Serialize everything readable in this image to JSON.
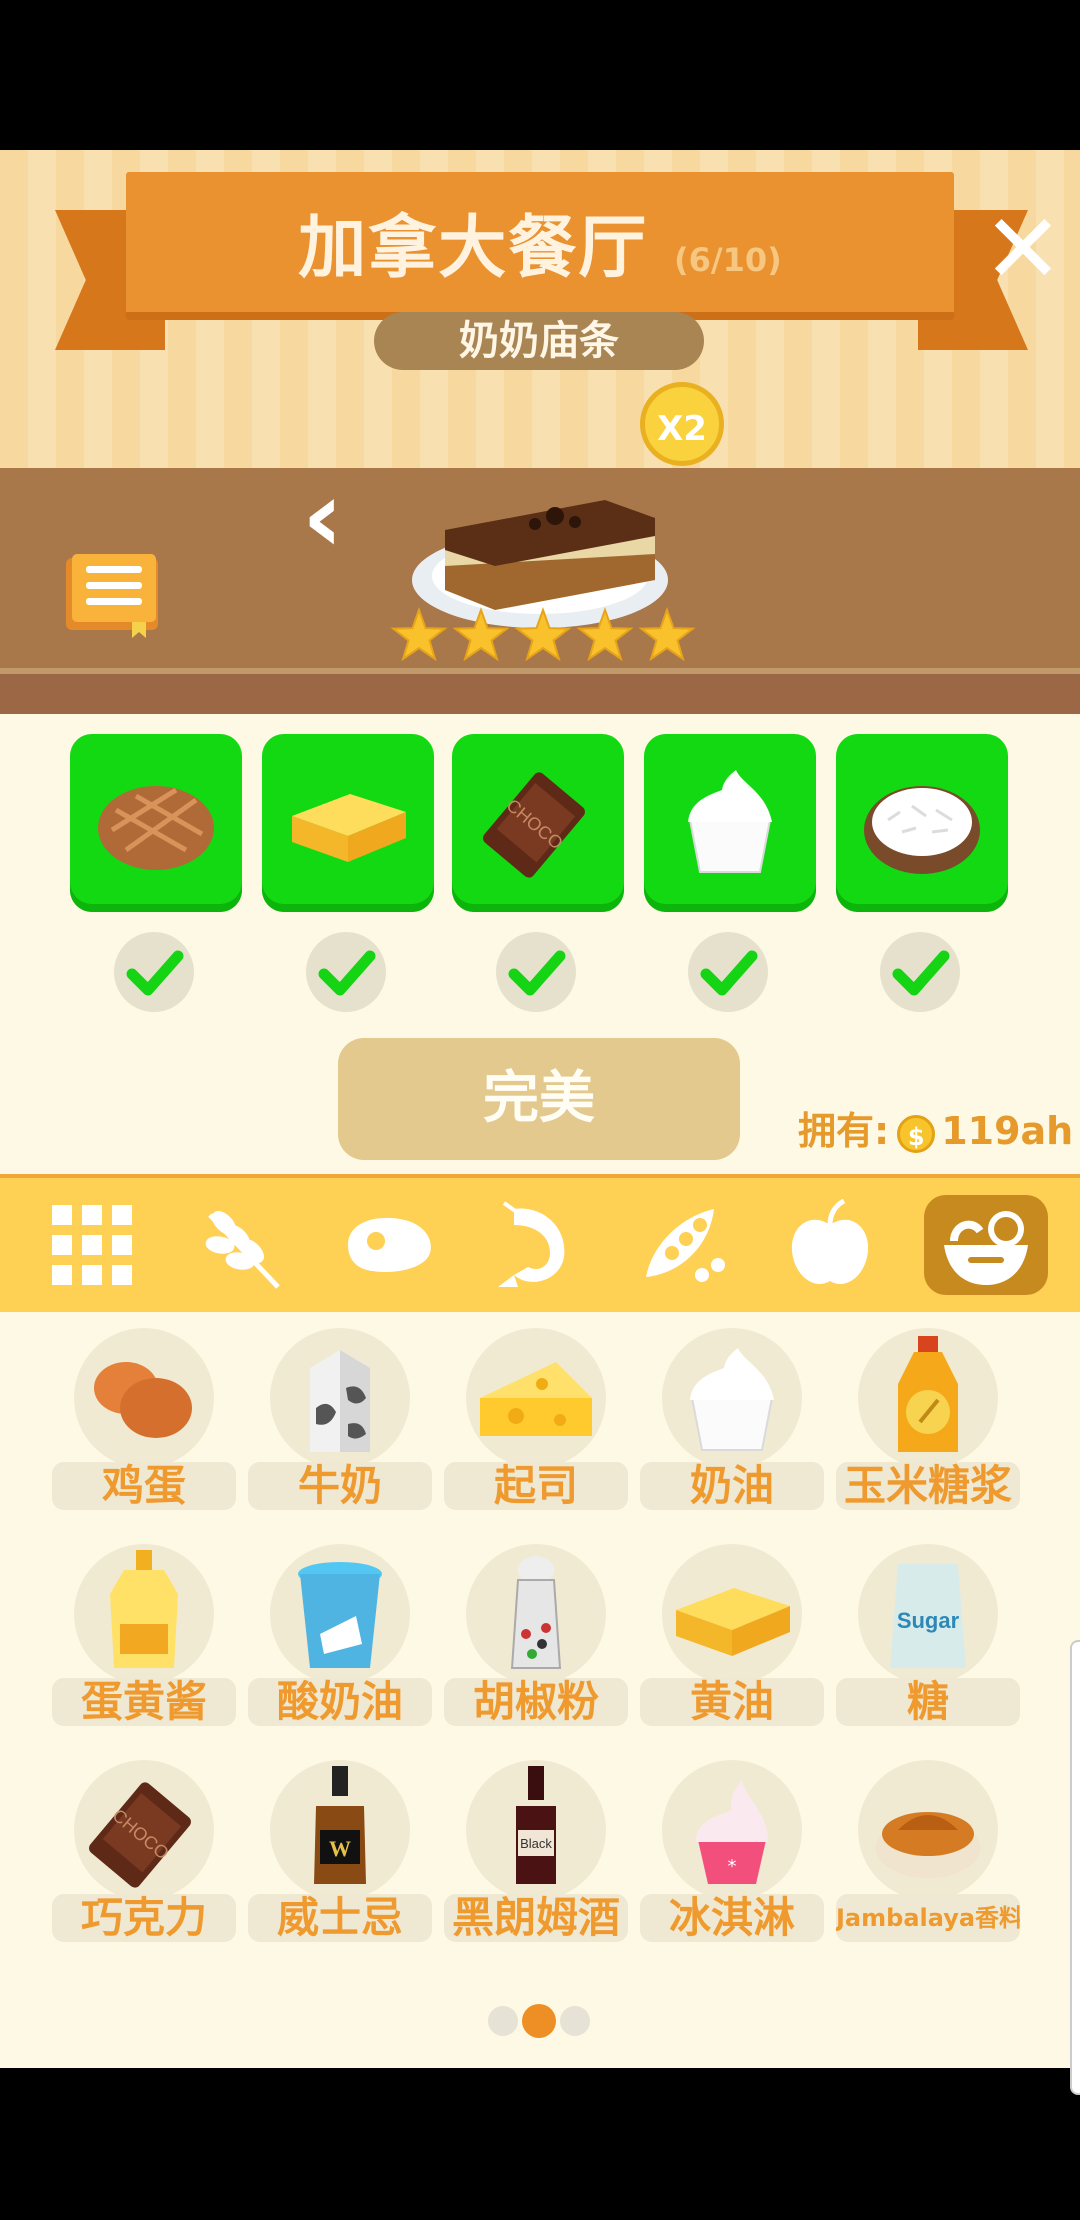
{
  "header": {
    "title": "加拿大餐厅",
    "progress": "(6/10)",
    "subtitle": "奶奶庙条",
    "multiplier": "X2",
    "close_icon": "close-icon"
  },
  "dish": {
    "name_icon": "chocolate-cake-dish",
    "stars": 5,
    "star_color": "#f9c22d"
  },
  "required_ingredients": [
    {
      "icon": "bread-icon",
      "checked": true
    },
    {
      "icon": "butter-icon",
      "checked": true
    },
    {
      "icon": "chocolate-icon",
      "checked": true
    },
    {
      "icon": "cream-icon",
      "checked": true
    },
    {
      "icon": "coconut-icon",
      "checked": true
    }
  ],
  "result_button": "完美",
  "ownership": {
    "label": "拥有:",
    "amount": "119ah"
  },
  "categories": [
    {
      "icon": "grid-icon",
      "active": false
    },
    {
      "icon": "wheat-icon",
      "active": false
    },
    {
      "icon": "meat-icon",
      "active": false
    },
    {
      "icon": "shrimp-icon",
      "active": false
    },
    {
      "icon": "peas-icon",
      "active": false
    },
    {
      "icon": "apple-icon",
      "active": false
    },
    {
      "icon": "bowl-icon",
      "active": true
    }
  ],
  "items": [
    {
      "label": "鸡蛋",
      "icon": "eggs-icon"
    },
    {
      "label": "牛奶",
      "icon": "milk-icon"
    },
    {
      "label": "起司",
      "icon": "cheese-icon"
    },
    {
      "label": "奶油",
      "icon": "cream-icon"
    },
    {
      "label": "玉米糖浆",
      "icon": "corn-syrup-icon"
    },
    {
      "label": "蛋黄酱",
      "icon": "mayonnaise-icon"
    },
    {
      "label": "酸奶油",
      "icon": "sour-cream-icon"
    },
    {
      "label": "胡椒粉",
      "icon": "pepper-icon"
    },
    {
      "label": "黄油",
      "icon": "butter-icon"
    },
    {
      "label": "糖",
      "icon": "sugar-icon",
      "pack_text": "Sugar"
    },
    {
      "label": "巧克力",
      "icon": "chocolate-icon"
    },
    {
      "label": "威士忌",
      "icon": "whiskey-icon",
      "bottle_text": "W"
    },
    {
      "label": "黑朗姆酒",
      "icon": "dark-rum-icon",
      "bottle_text": "Black"
    },
    {
      "label": "冰淇淋",
      "icon": "ice-cream-icon"
    },
    {
      "label": "Jambalaya香料",
      "icon": "spice-icon"
    }
  ],
  "pagination": {
    "pages": 3,
    "current": 2
  }
}
